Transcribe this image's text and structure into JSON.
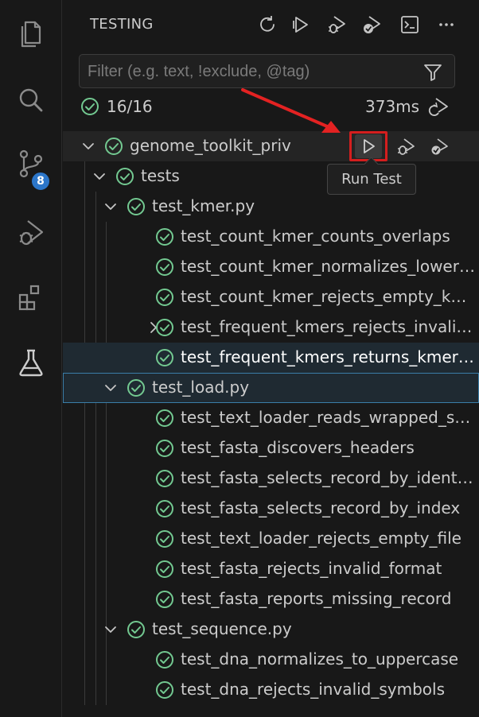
{
  "header": {
    "title": "TESTING",
    "actions": [
      "refresh-icon",
      "run-all-icon",
      "debug-all-icon",
      "run-coverage-icon",
      "terminal-icon",
      "more-icon"
    ]
  },
  "activity_bar": {
    "items": [
      "explorer-icon",
      "search-icon",
      "source-control-icon",
      "run-debug-icon",
      "extensions-icon",
      "testing-icon"
    ],
    "source_control_badge": "8"
  },
  "filter": {
    "placeholder": "Filter (e.g. text, !exclude, @tag)",
    "value": ""
  },
  "summary": {
    "count": "16/16",
    "duration": "373ms"
  },
  "tooltip": {
    "text": "Run Test"
  },
  "tree": {
    "root": "genome_toolkit_priv",
    "folder": "tests",
    "files": [
      {
        "name": "test_kmer.py",
        "tests": [
          "test_count_kmer_counts_overlaps",
          "test_count_kmer_normalizes_lower…",
          "test_count_kmer_rejects_empty_km…",
          "test_frequent_kmers_rejects_invalid…",
          "test_frequent_kmers_returns_kmer…"
        ]
      },
      {
        "name": "test_load.py",
        "tests": [
          "test_text_loader_reads_wrapped_se…",
          "test_fasta_discovers_headers",
          "test_fasta_selects_record_by_identi…",
          "test_fasta_selects_record_by_index",
          "test_text_loader_rejects_empty_file",
          "test_fasta_rejects_invalid_format",
          "test_fasta_reports_missing_record"
        ]
      },
      {
        "name": "test_sequence.py",
        "tests": [
          "test_dna_normalizes_to_uppercase",
          "test_dna_rejects_invalid_symbols"
        ]
      }
    ]
  },
  "colors": {
    "pass": "#73c991",
    "annotation": "#e32222",
    "accent": "#2c76c9"
  }
}
